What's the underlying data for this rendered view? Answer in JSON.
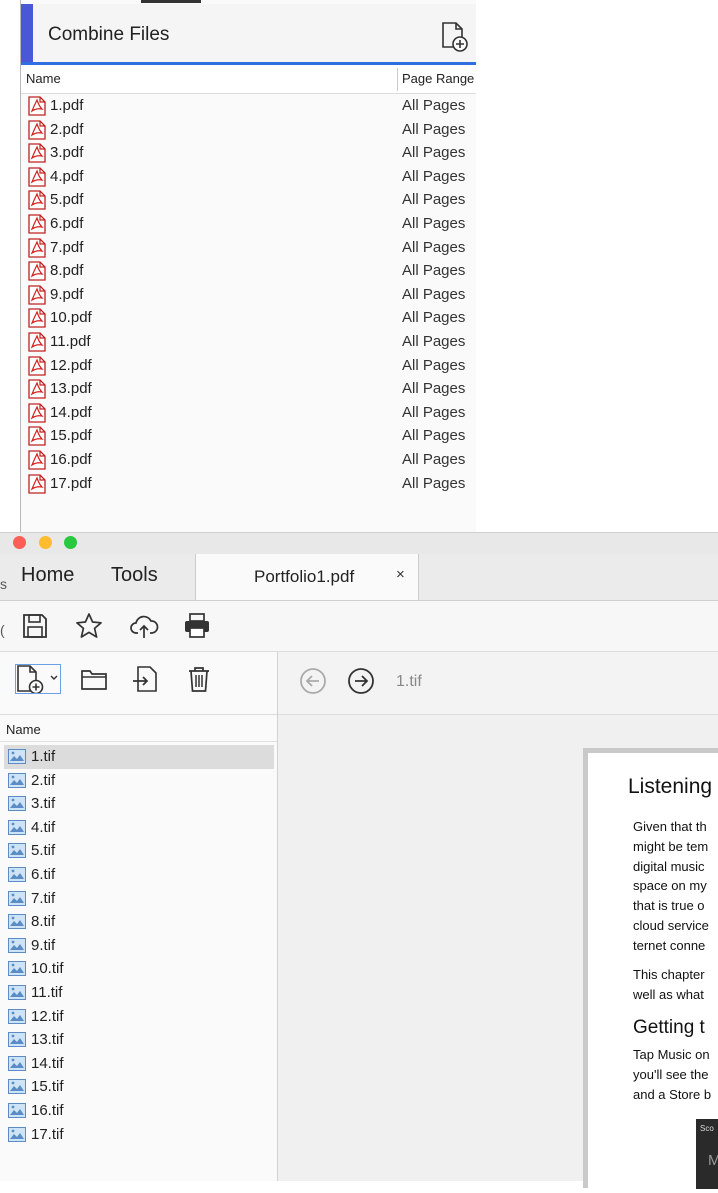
{
  "combine": {
    "title": "Combine Files",
    "columns": {
      "name": "Name",
      "page_range": "Page Range"
    },
    "files": [
      {
        "name": "1.pdf",
        "range": "All Pages"
      },
      {
        "name": "2.pdf",
        "range": "All Pages"
      },
      {
        "name": "3.pdf",
        "range": "All Pages"
      },
      {
        "name": "4.pdf",
        "range": "All Pages"
      },
      {
        "name": "5.pdf",
        "range": "All Pages"
      },
      {
        "name": "6.pdf",
        "range": "All Pages"
      },
      {
        "name": "7.pdf",
        "range": "All Pages"
      },
      {
        "name": "8.pdf",
        "range": "All Pages"
      },
      {
        "name": "9.pdf",
        "range": "All Pages"
      },
      {
        "name": "10.pdf",
        "range": "All Pages"
      },
      {
        "name": "11.pdf",
        "range": "All Pages"
      },
      {
        "name": "12.pdf",
        "range": "All Pages"
      },
      {
        "name": "13.pdf",
        "range": "All Pages"
      },
      {
        "name": "14.pdf",
        "range": "All Pages"
      },
      {
        "name": "15.pdf",
        "range": "All Pages"
      },
      {
        "name": "16.pdf",
        "range": "All Pages"
      },
      {
        "name": "17.pdf",
        "range": "All Pages"
      }
    ]
  },
  "window": {
    "nav": {
      "home": "Home",
      "tools": "Tools"
    },
    "tab": {
      "title": "Portfolio1.pdf",
      "close": "×"
    },
    "toolbar_icons": [
      "save-icon",
      "star-icon",
      "cloud-upload-icon",
      "print-icon"
    ]
  },
  "portfolio": {
    "tools_icons": [
      "add-file-icon",
      "folder-icon",
      "extract-icon",
      "trash-icon"
    ],
    "name_header": "Name",
    "files": [
      "1.tif",
      "2.tif",
      "3.tif",
      "4.tif",
      "5.tif",
      "6.tif",
      "7.tif",
      "8.tif",
      "9.tif",
      "10.tif",
      "11.tif",
      "12.tif",
      "13.tif",
      "14.tif",
      "15.tif",
      "16.tif",
      "17.tif"
    ],
    "selected_index": 0
  },
  "preview": {
    "current_file": "1.tif",
    "heading": "Listening",
    "para1": [
      "Given that th",
      "might be tem",
      "digital music",
      "space on my ",
      "that is true o",
      "cloud service",
      "ternet conne"
    ],
    "para2": [
      "This chapter ",
      "well as what "
    ],
    "subheading": "Getting t",
    "para3": [
      "Tap Music on",
      "you'll see the",
      "and a Store b"
    ],
    "thumb_label": "Sco",
    "thumb_letter": "M"
  },
  "edge_glyphs": [
    "s",
    "("
  ],
  "colors": {
    "accent_blue": "#2f6fe0",
    "pdf_red": "#d32020",
    "close": "#fd5f57",
    "minimize": "#febc2e",
    "zoom": "#28c840"
  }
}
